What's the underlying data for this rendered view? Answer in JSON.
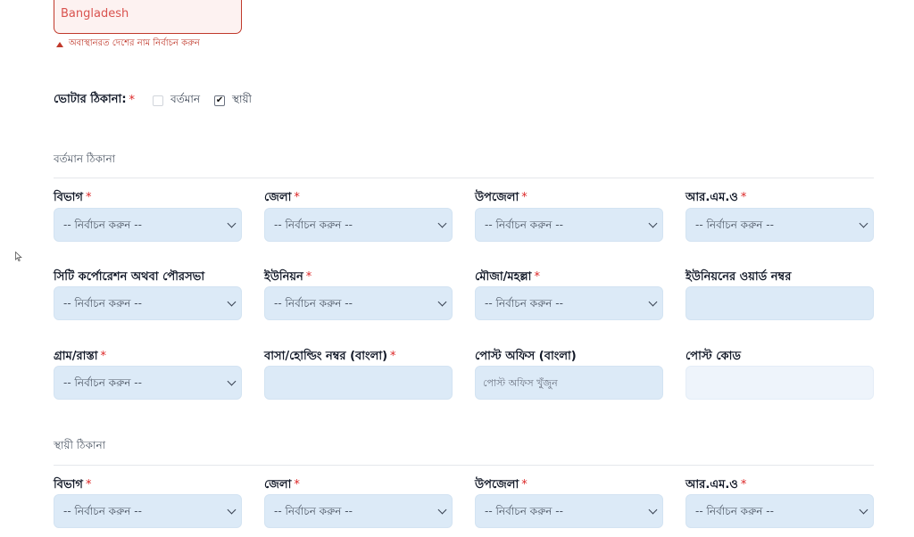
{
  "country": {
    "value": "Bangladesh",
    "error": "অবাস্থানরত দেশের নাম নির্বাচন করুন"
  },
  "voter_address": {
    "label": "ভোটার ঠিকানা:",
    "required": "*",
    "options": [
      {
        "label": "বর্তমান",
        "checked": false
      },
      {
        "label": "স্থায়ী",
        "checked": true
      }
    ]
  },
  "sections": {
    "present": {
      "title": "বর্তমান ঠিকানা",
      "fields": {
        "division": {
          "label": "বিভাগ",
          "req": "*",
          "value": "-- নির্বাচন করুন --"
        },
        "district": {
          "label": "জেলা",
          "req": "*",
          "value": "-- নির্বাচন করুন --"
        },
        "upazila": {
          "label": "উপজেলা",
          "req": "*",
          "value": "-- নির্বাচন করুন --"
        },
        "rmo": {
          "label": "আর.এম.ও",
          "req": "*",
          "value": "-- নির্বাচন করুন --"
        },
        "city": {
          "label": "সিটি কর্পোরেশন অথবা পৌরসভা",
          "value": "-- নির্বাচন করুন --"
        },
        "union": {
          "label": "ইউনিয়ন",
          "req": "*",
          "value": "-- নির্বাচন করুন --"
        },
        "mouza": {
          "label": "মৌজা/মহল্লা",
          "req": "*",
          "value": "-- নির্বাচন করুন --"
        },
        "ward": {
          "label": "ইউনিয়নের ওয়ার্ড নম্বর",
          "value": ""
        },
        "village": {
          "label": "গ্রাম/রাস্তা",
          "req": "*",
          "value": "-- নির্বাচন করুন --"
        },
        "holding": {
          "label": "বাসা/হোল্ডিং নম্বর (বাংলা)",
          "req": "*",
          "value": ""
        },
        "post_office": {
          "label": "পোস্ট অফিস (বাংলা)",
          "placeholder": "পোস্ট অফিস খুঁজুন"
        },
        "post_code": {
          "label": "পোস্ট কোড",
          "value": ""
        }
      }
    },
    "permanent": {
      "title": "স্থায়ী ঠিকানা",
      "fields": {
        "division": {
          "label": "বিভাগ",
          "req": "*",
          "value": "-- নির্বাচন করুন --"
        },
        "district": {
          "label": "জেলা",
          "req": "*",
          "value": "-- নির্বাচন করুন --"
        },
        "upazila": {
          "label": "উপজেলা",
          "req": "*",
          "value": "-- নির্বাচন করুন --"
        },
        "rmo": {
          "label": "আর.এম.ও",
          "req": "*",
          "value": "-- নির্বাচন করুন --"
        }
      }
    }
  }
}
